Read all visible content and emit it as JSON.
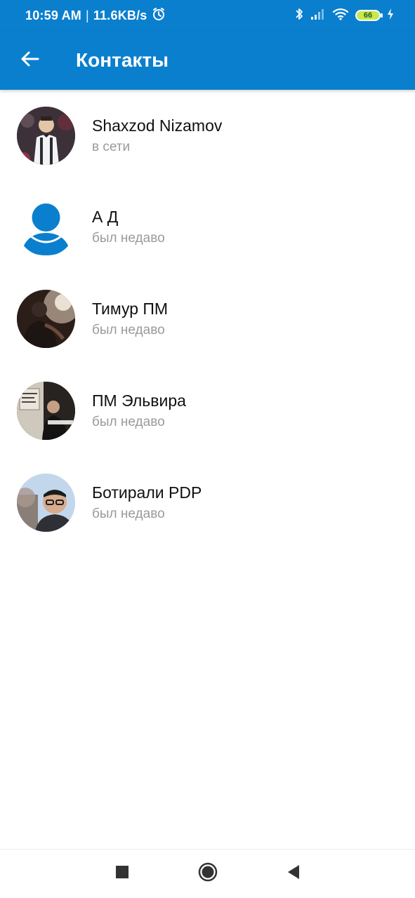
{
  "status_bar": {
    "time": "10:59 AM",
    "separator": "|",
    "net_speed": "11.6KB/s",
    "battery_level": "66"
  },
  "app_bar": {
    "title": "Контакты",
    "back_icon": "arrow-left-icon"
  },
  "contacts": [
    {
      "name": "Shaxzod Nizamov",
      "status": "в сети"
    },
    {
      "name": "А Д",
      "status": "был недаво"
    },
    {
      "name": "Тимур ПМ",
      "status": "был недаво"
    },
    {
      "name": "ПМ Эльвира",
      "status": "был недаво"
    },
    {
      "name": "Ботирали PDP",
      "status": "был недаво"
    }
  ],
  "nav_bar": {
    "recents_icon": "square-icon",
    "home_icon": "circle-icon",
    "back_icon": "triangle-back-icon"
  },
  "colors": {
    "primary": "#0a7fce",
    "secondary_text": "#9a9a9a",
    "placeholder_avatar": "#0a7fce"
  }
}
